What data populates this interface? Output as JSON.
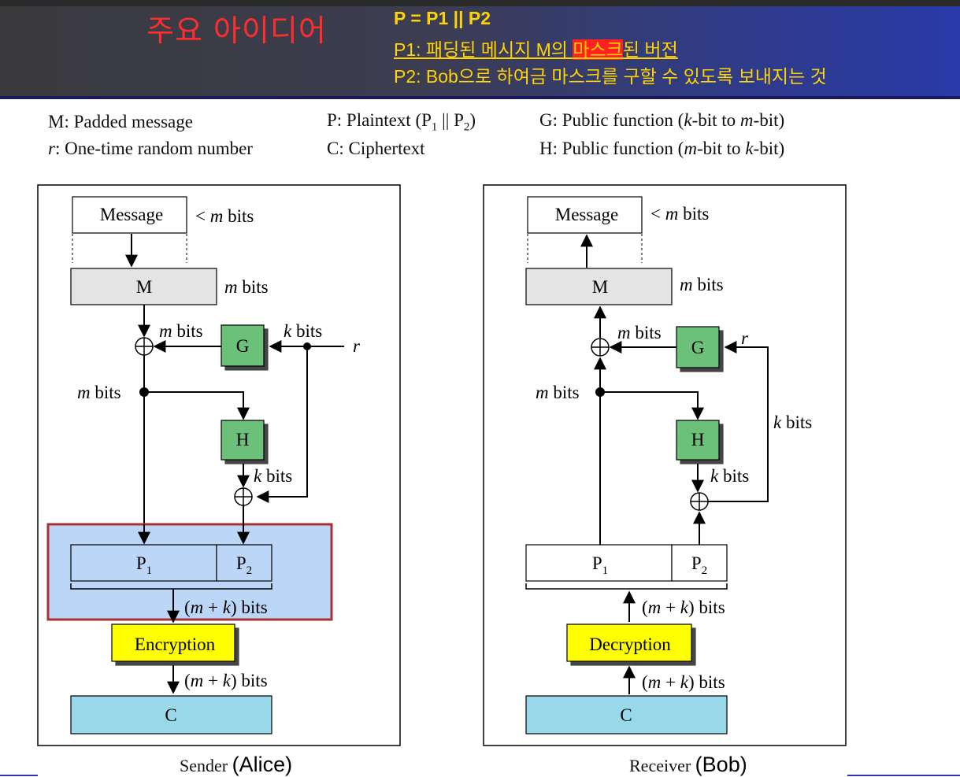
{
  "header": {
    "title": "주요 아이디어",
    "line1": "P = P1 ||  P2",
    "line2_pre": "P1: 패딩된 메시지 M의 ",
    "line2_hl": "마스크",
    "line2_post": "된 버전",
    "line3": "P2: Bob으로 하여금 마스크를 구할 수 있도록 보내지는 것"
  },
  "legend": {
    "m": "M: Padded message",
    "r": "r: One-time random number",
    "p": "P: Plaintext (P1 || P2)",
    "c": "C: Ciphertext",
    "g": "G: Public function (k-bit to m-bit)",
    "h": "H: Public function (m-bit to k-bit)"
  },
  "sender": {
    "message": "Message",
    "msg_size": "< m bits",
    "M": "M",
    "m_bits": "m bits",
    "G": "G",
    "H": "H",
    "k_bits": "k bits",
    "r": "r",
    "P1": "P1",
    "P2": "P2",
    "mk_bits": "(m + k) bits",
    "encryption": "Encryption",
    "C": "C",
    "label": "Sender",
    "who": "(Alice)"
  },
  "receiver": {
    "message": "Message",
    "msg_size": "< m bits",
    "M": "M",
    "m_bits": "m bits",
    "G": "G",
    "H": "H",
    "k_bits": "k bits",
    "r": "r",
    "P1": "P1",
    "P2": "P2",
    "mk_bits": "(m + k) bits",
    "decryption": "Decryption",
    "C": "C",
    "label": "Receiver",
    "who": "(Bob)"
  },
  "colors": {
    "header_title": "#ff2d2d",
    "header_text": "#ffd400",
    "highlight": "#ff2020",
    "box_gray": "#e4e4e4",
    "box_green": "#6cc07a",
    "box_yellow": "#ffff00",
    "box_cyan": "#98d8e8",
    "highlight_region": "#bcd6f8",
    "highlight_border": "#a83232"
  }
}
